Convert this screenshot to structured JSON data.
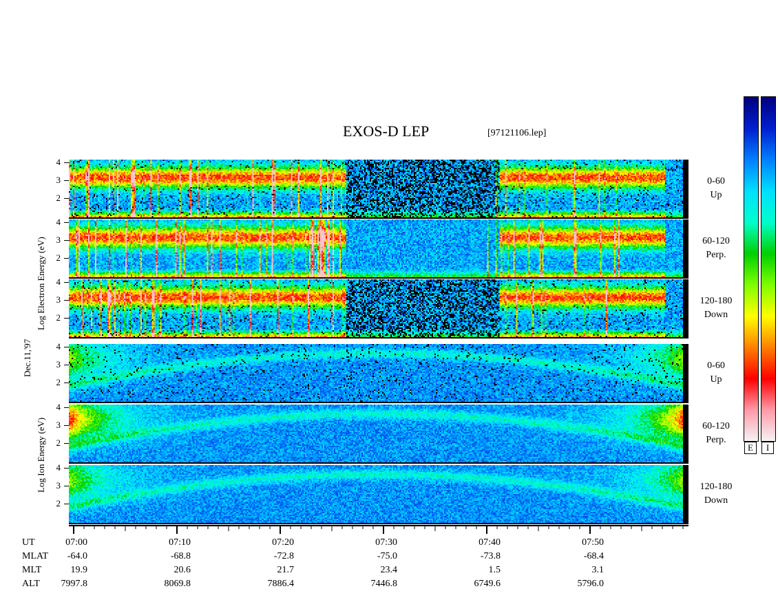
{
  "chart_data": {
    "type": "heatmap",
    "title": "EXOS-D LEP",
    "subtitle": "[97121106.lep]",
    "date_label": "Dec.11,'97",
    "x_axis": {
      "label": "UT",
      "ticks": [
        "07:00",
        "07:10",
        "07:20",
        "07:30",
        "07:40",
        "07:50"
      ]
    },
    "orbit_rows": [
      {
        "label": "UT",
        "values": [
          "07:00",
          "07:10",
          "07:20",
          "07:30",
          "07:40",
          "07:50"
        ]
      },
      {
        "label": "MLAT",
        "values": [
          "-64.0",
          "-68.8",
          "-72.8",
          "-75.0",
          "-73.8",
          "-68.4"
        ]
      },
      {
        "label": "MLT",
        "values": [
          "19.9",
          "20.6",
          "21.7",
          "23.4",
          "1.5",
          "3.1"
        ]
      },
      {
        "label": "ALT",
        "values": [
          "7997.8",
          "8069.8",
          "7886.4",
          "7446.8",
          "6749.6",
          "5796.0"
        ]
      }
    ],
    "groups": [
      {
        "name_lines": [
          "Log",
          "Electron",
          "Energy",
          "(eV)"
        ],
        "vertical_label": "Log   Electron   Energy (eV)",
        "panels": [
          {
            "pitch": "0-60",
            "dir": "Up",
            "y_ticks": [
              "4",
              "3",
              "2"
            ]
          },
          {
            "pitch": "60-120",
            "dir": "Perp.",
            "y_ticks": [
              "4",
              "3",
              "2"
            ]
          },
          {
            "pitch": "120-180",
            "dir": "Down",
            "y_ticks": [
              "4",
              "3",
              "2"
            ]
          }
        ]
      },
      {
        "vertical_label": "Log   Ion   Energy (eV)",
        "panels": [
          {
            "pitch": "0-60",
            "dir": "Up",
            "y_ticks": [
              "4",
              "3",
              "2"
            ]
          },
          {
            "pitch": "60-120",
            "dir": "Perp.",
            "y_ticks": [
              "4",
              "3",
              "2"
            ]
          },
          {
            "pitch": "120-180",
            "dir": "Down",
            "y_ticks": [
              "4",
              "3",
              "2"
            ]
          }
        ]
      }
    ],
    "colorbars": [
      {
        "label": "E"
      },
      {
        "label": "I"
      }
    ],
    "colors": {
      "background_blue": "#0b1f9a",
      "colormap": [
        "#f5f5f5",
        "#ff9aa8",
        "#ff0000",
        "#ff8000",
        "#ffff00",
        "#7fff00",
        "#00d000",
        "#00ffcc",
        "#00e0ff",
        "#0080ff",
        "#0020d0",
        "#000080"
      ]
    }
  }
}
